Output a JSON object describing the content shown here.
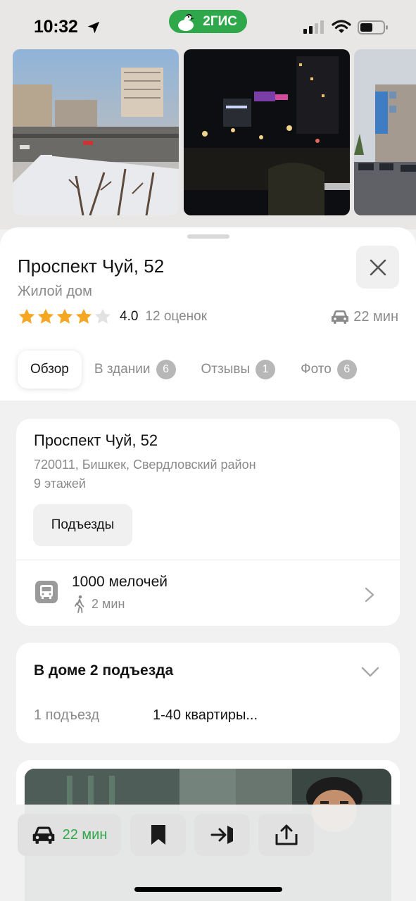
{
  "status_bar": {
    "time": "10:32",
    "brand": "2ГИС",
    "icons": [
      "location-arrow-icon",
      "cellular-signal-icon",
      "wifi-icon",
      "battery-icon"
    ]
  },
  "photos": [
    {
      "name": "daytime-street-view"
    },
    {
      "name": "night-city-view"
    },
    {
      "name": "street-buildings-view"
    }
  ],
  "place": {
    "title": "Проспект Чуй, 52",
    "category": "Жилой дом",
    "rating": 4.0,
    "rating_text": "4.0",
    "stars_filled": 4,
    "stars_total": 5,
    "reviews_count": "12 оценок",
    "drive_time": "22 мин"
  },
  "tabs": [
    {
      "label": "Обзор",
      "badge": "",
      "active": true
    },
    {
      "label": "В здании",
      "badge": "6"
    },
    {
      "label": "Отзывы",
      "badge": "1"
    },
    {
      "label": "Фото",
      "badge": "6"
    }
  ],
  "address_card": {
    "title": "Проспект Чуй, 52",
    "detail": "720011, Бишкек, Свердловский район",
    "floors": "9 этажей",
    "entrances_button": "Подъезды",
    "stop_name": "1000 мелочей",
    "walk_time": "2 мин"
  },
  "entrances_card": {
    "title": "В доме 2 подъезда",
    "entrance_label": "1 подъезд",
    "entrance_value": "1-40 квартиры..."
  },
  "bottom_bar": {
    "route_time": "22 мин",
    "icons": [
      "car-icon",
      "bookmark-icon",
      "login-arrow-icon",
      "share-icon"
    ]
  },
  "colors": {
    "brand_green": "#2ea84a",
    "star_gold": "#f5a623",
    "muted_text": "#8a8a8a",
    "badge_grey": "#b7b7b7"
  }
}
